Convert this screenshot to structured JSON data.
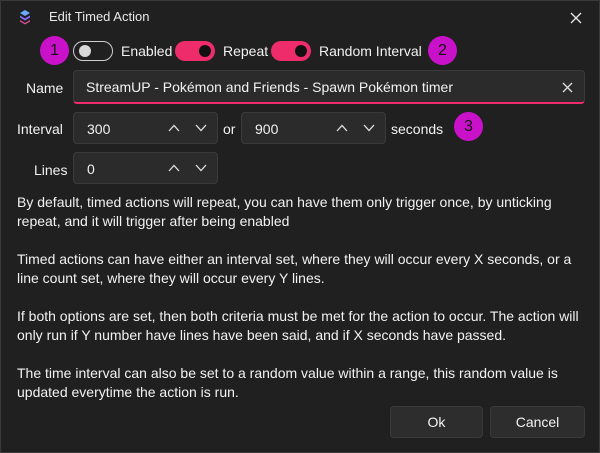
{
  "window": {
    "title": "Edit Timed Action"
  },
  "colors": {
    "accent": "#ee2b6b",
    "badge": "#c911c9",
    "background": "#202020"
  },
  "badges": [
    "1",
    "2",
    "3"
  ],
  "toggles": {
    "enabled": {
      "label": "Enabled",
      "on": false
    },
    "repeat": {
      "label": "Repeat",
      "on": true
    },
    "random_interval": {
      "label": "Random Interval",
      "on": true
    }
  },
  "name": {
    "label": "Name",
    "value": "StreamUP - Pokémon and Friends - Spawn Pokémon timer"
  },
  "interval": {
    "label": "Interval",
    "min": "300",
    "separator": "or",
    "max": "900",
    "unit": "seconds"
  },
  "lines": {
    "label": "Lines",
    "value": "0"
  },
  "description": [
    "By default, timed actions will repeat, you can have them only trigger once, by unticking repeat, and it will trigger after being enabled",
    "Timed actions can have either an interval set, where they will occur every X seconds, or a line count set, where they will occur every Y lines.",
    "If both options are set, then both criteria must be met for the action to occur. The action will only run if Y number have lines have been said, and if X seconds have passed.",
    "The time interval can also be set to a random value within a range, this random value is updated everytime the action is run."
  ],
  "buttons": {
    "ok": "Ok",
    "cancel": "Cancel"
  },
  "icons": [
    "app-logo-icon",
    "close-icon",
    "clear-icon",
    "chevron-up-icon",
    "chevron-down-icon"
  ]
}
